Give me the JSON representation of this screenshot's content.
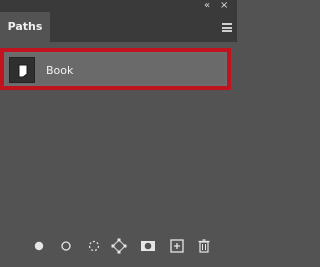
{
  "panel": {
    "collapse_glyph": "«",
    "close_glyph": "×",
    "tab_label": "Paths"
  },
  "paths": [
    {
      "name": "Book",
      "selected": true
    }
  ],
  "colors": {
    "selection_outline": "#c1121f",
    "panel_bg": "#535353",
    "tab_bar_bg": "#3a3a3a"
  },
  "toolbar": [
    {
      "icon": "fill-path-icon"
    },
    {
      "icon": "stroke-path-icon"
    },
    {
      "icon": "load-path-as-selection-icon"
    },
    {
      "icon": "make-work-path-icon"
    },
    {
      "icon": "add-mask-icon"
    },
    {
      "icon": "create-new-path-icon"
    },
    {
      "icon": "delete-path-icon"
    }
  ]
}
